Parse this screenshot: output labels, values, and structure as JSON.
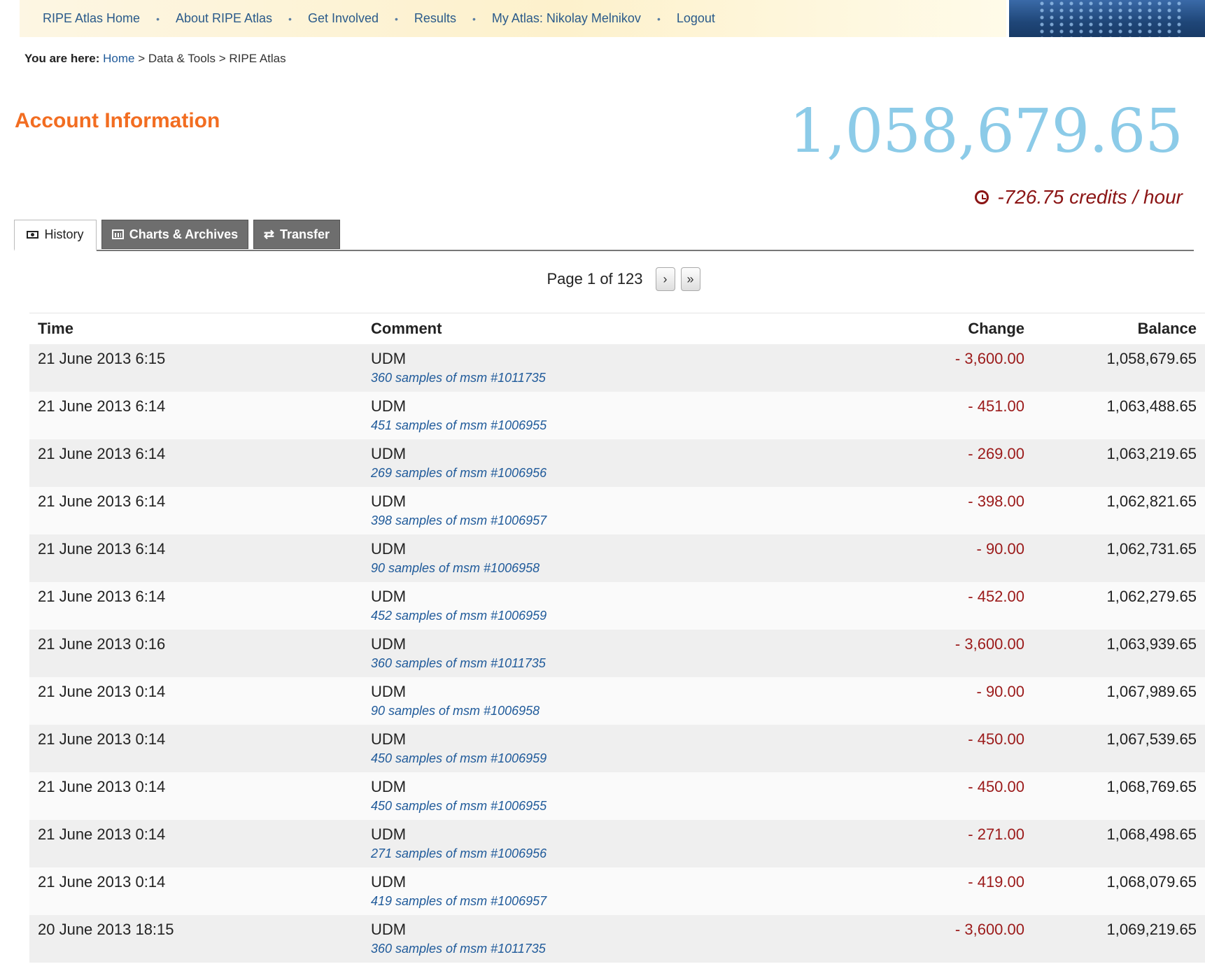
{
  "nav": {
    "items": [
      "RIPE Atlas Home",
      "About RIPE Atlas",
      "Get Involved",
      "Results",
      "My Atlas: Nikolay Melnikov",
      "Logout"
    ],
    "separator": "•"
  },
  "breadcrumb": {
    "label": "You are here:",
    "home": "Home",
    "sep": ">",
    "data_tools": "Data & Tools",
    "current": "RIPE Atlas"
  },
  "page": {
    "title": "Account Information",
    "balance": "1,058,679.65",
    "rate": "-726.75 credits / hour"
  },
  "tabs": [
    {
      "label": "History",
      "icon": "money-icon"
    },
    {
      "label": "Charts & Archives",
      "icon": "bar-chart-icon"
    },
    {
      "label": "Transfer",
      "icon": "transfer-arrows-icon"
    }
  ],
  "pager": {
    "text": "Page 1 of 123",
    "next": "›",
    "last": "»"
  },
  "table": {
    "headers": {
      "time": "Time",
      "comment": "Comment",
      "change": "Change",
      "balance": "Balance"
    },
    "rows": [
      {
        "time": "21 June 2013 6:15",
        "title": "UDM",
        "sub": "360 samples of msm #1011735",
        "change": "- 3,600.00",
        "balance": "1,058,679.65"
      },
      {
        "time": "21 June 2013 6:14",
        "title": "UDM",
        "sub": "451 samples of msm #1006955",
        "change": "- 451.00",
        "balance": "1,063,488.65"
      },
      {
        "time": "21 June 2013 6:14",
        "title": "UDM",
        "sub": "269 samples of msm #1006956",
        "change": "- 269.00",
        "balance": "1,063,219.65"
      },
      {
        "time": "21 June 2013 6:14",
        "title": "UDM",
        "sub": "398 samples of msm #1006957",
        "change": "- 398.00",
        "balance": "1,062,821.65"
      },
      {
        "time": "21 June 2013 6:14",
        "title": "UDM",
        "sub": "90 samples of msm #1006958",
        "change": "- 90.00",
        "balance": "1,062,731.65"
      },
      {
        "time": "21 June 2013 6:14",
        "title": "UDM",
        "sub": "452 samples of msm #1006959",
        "change": "- 452.00",
        "balance": "1,062,279.65"
      },
      {
        "time": "21 June 2013 0:16",
        "title": "UDM",
        "sub": "360 samples of msm #1011735",
        "change": "- 3,600.00",
        "balance": "1,063,939.65"
      },
      {
        "time": "21 June 2013 0:14",
        "title": "UDM",
        "sub": "90 samples of msm #1006958",
        "change": "- 90.00",
        "balance": "1,067,989.65"
      },
      {
        "time": "21 June 2013 0:14",
        "title": "UDM",
        "sub": "450 samples of msm #1006959",
        "change": "- 450.00",
        "balance": "1,067,539.65"
      },
      {
        "time": "21 June 2013 0:14",
        "title": "UDM",
        "sub": "450 samples of msm #1006955",
        "change": "- 450.00",
        "balance": "1,068,769.65"
      },
      {
        "time": "21 June 2013 0:14",
        "title": "UDM",
        "sub": "271 samples of msm #1006956",
        "change": "- 271.00",
        "balance": "1,068,498.65"
      },
      {
        "time": "21 June 2013 0:14",
        "title": "UDM",
        "sub": "419 samples of msm #1006957",
        "change": "- 419.00",
        "balance": "1,068,079.65"
      },
      {
        "time": "20 June 2013 18:15",
        "title": "UDM",
        "sub": "360 samples of msm #1011735",
        "change": "- 3,600.00",
        "balance": "1,069,219.65"
      }
    ]
  },
  "colors": {
    "accent_orange": "#f26d21",
    "balance_blue": "#8ccbe8",
    "negative_red": "#9b1a1a",
    "link_blue": "#1f5a9a"
  }
}
